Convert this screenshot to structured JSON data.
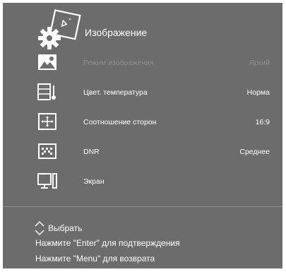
{
  "menu": {
    "title": "Изображение",
    "items": [
      {
        "label": "Режим изображения",
        "value": "Яркий",
        "icon": "picture-mode-icon",
        "enabled": false
      },
      {
        "label": "Цвет. температура",
        "value": "Норма",
        "icon": "color-temperature-icon",
        "enabled": true
      },
      {
        "label": "Соотношение сторон",
        "value": "16:9",
        "icon": "aspect-ratio-icon",
        "enabled": true
      },
      {
        "label": "DNR",
        "value": "Среднее",
        "icon": "noise-reduction-icon",
        "enabled": true
      },
      {
        "label": "Экран",
        "value": "",
        "icon": "screen-icon",
        "enabled": true
      }
    ]
  },
  "footer": {
    "select_hint": "Выбрать",
    "enter_hint": "Нажмите \"Enter\" для подтверждения",
    "menu_hint": "Нажмите \"Menu\" для возврата"
  },
  "colors": {
    "panel_bg": "#6c6c6c",
    "text": "#ffffff",
    "disabled_text": "#8f8f8f"
  }
}
